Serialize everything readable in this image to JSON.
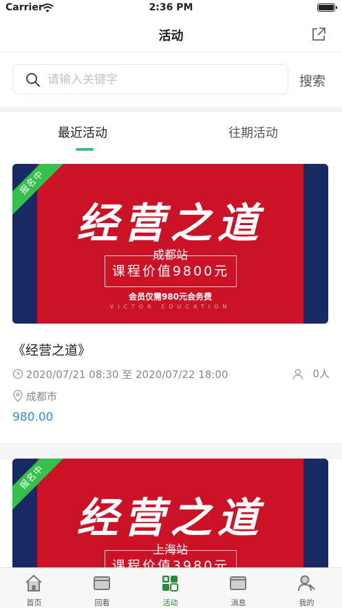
{
  "status_bar": {
    "carrier": "Carrier",
    "time": "2:36 PM"
  },
  "nav": {
    "title": "活动"
  },
  "search": {
    "placeholder": "请输入关键字",
    "button_label": "搜索"
  },
  "tabs": [
    {
      "label": "最近活动",
      "active": true
    },
    {
      "label": "往期活动",
      "active": false
    }
  ],
  "events": [
    {
      "banner": {
        "title": "经营之道",
        "city": "成都站",
        "price_text": "课程价值9800元",
        "member_text": "会员仅需980元会务费",
        "brand_text": "VICTOR EDUCATION",
        "badge": "报名中"
      },
      "title": "《经营之道》",
      "time": "2020/07/21 08:30 至 2020/07/22 18:00",
      "attendees": "0人",
      "location": "成都市",
      "price": "980.00"
    },
    {
      "banner": {
        "title": "经营之道",
        "city": "上海站",
        "price_text": "课程价值3980元",
        "badge": "报名中"
      }
    }
  ],
  "tab_bar": [
    {
      "label": "首页",
      "icon": "home-icon"
    },
    {
      "label": "回看",
      "icon": "replay-icon"
    },
    {
      "label": "活动",
      "icon": "activity-icon",
      "active": true
    },
    {
      "label": "消息",
      "icon": "message-icon"
    },
    {
      "label": "我的",
      "icon": "profile-icon"
    }
  ],
  "colors": {
    "accent_green": "#35c27a",
    "banner_red": "#cc1226",
    "banner_navy": "#172a63",
    "price_blue": "#2f8ed9",
    "tab_active": "#2c8a39"
  }
}
